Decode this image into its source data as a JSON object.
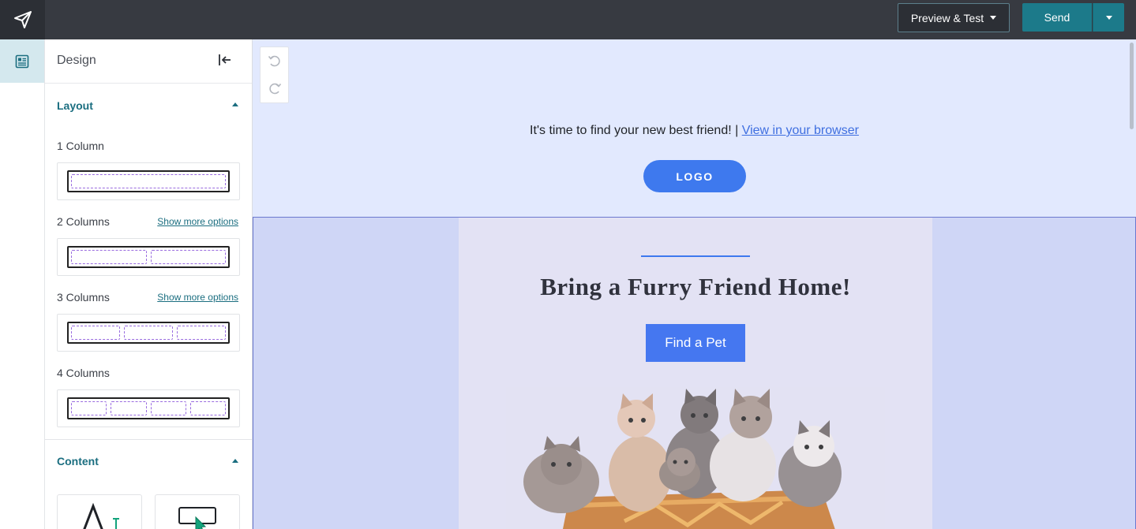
{
  "topbar": {
    "preview_label": "Preview & Test",
    "send_label": "Send"
  },
  "panel": {
    "title": "Design",
    "layout_section": "Layout",
    "content_section": "Content",
    "options": [
      {
        "label": "1 Column",
        "more": ""
      },
      {
        "label": "2 Columns",
        "more": "Show more options"
      },
      {
        "label": "3 Columns",
        "more": "Show more options"
      },
      {
        "label": "4 Columns",
        "more": ""
      }
    ]
  },
  "canvas": {
    "preheader_text": "It's time to find your new best friend! | ",
    "preheader_link": "View in your browser",
    "logo_label": "LOGO",
    "hero_title": "Bring a Furry Friend Home!",
    "hero_button": "Find a Pet"
  },
  "colors": {
    "topbar": "#373a41",
    "accent": "#1c7a8a",
    "canvas_bg": "#e2e9fe",
    "email_blue": "#3e79ee"
  },
  "icons": [
    "send-plane-icon",
    "caret-down-icon",
    "design-panel-icon",
    "collapse-left-icon",
    "chevron-up-icon",
    "undo-icon",
    "redo-icon",
    "text-block-icon",
    "button-block-icon"
  ]
}
